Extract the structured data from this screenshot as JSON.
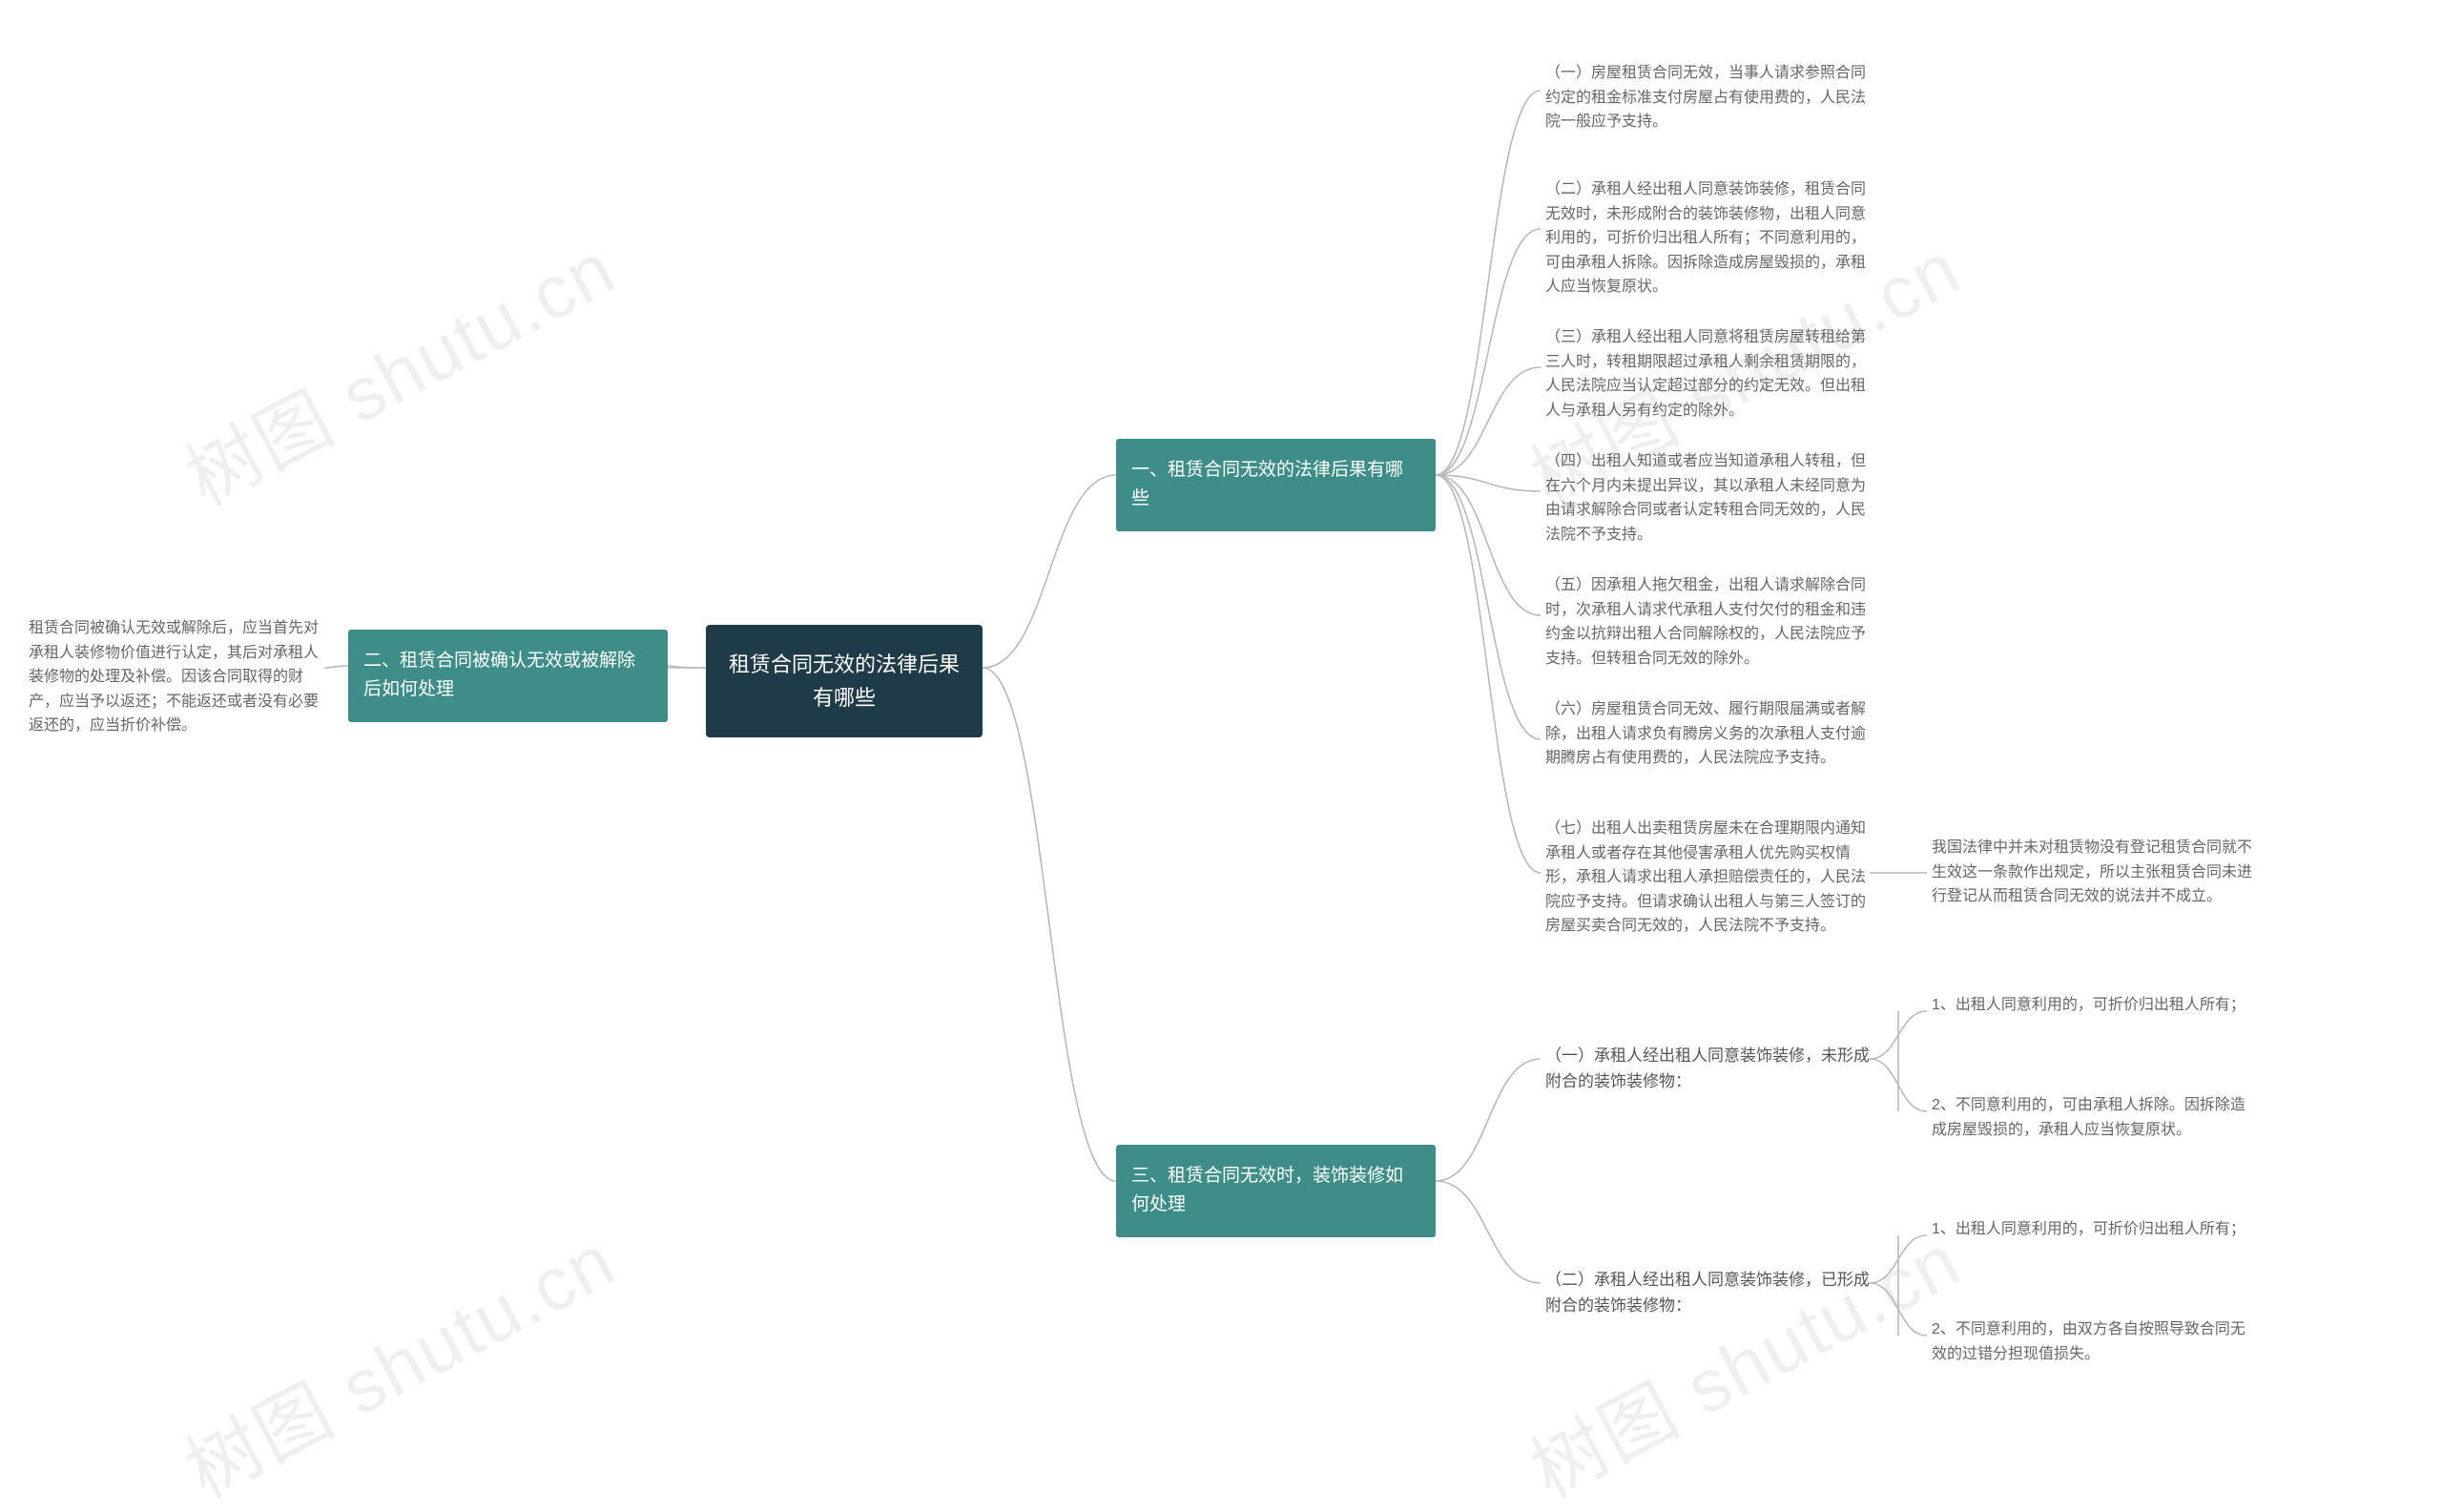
{
  "watermark": "树图 shutu.cn",
  "root": {
    "title": "租赁合同无效的法律后果\n有哪些"
  },
  "branch1": {
    "title": "一、租赁合同无效的法律后果有哪\n些",
    "items": [
      "（一）房屋租赁合同无效，当事人请求参照合同约定的租金标准支付房屋占有使用费的，人民法院一般应予支持。",
      "（二）承租人经出租人同意装饰装修，租赁合同无效时，未形成附合的装饰装修物，出租人同意利用的，可折价归出租人所有；不同意利用的，可由承租人拆除。因拆除造成房屋毁损的，承租人应当恢复原状。",
      "（三）承租人经出租人同意将租赁房屋转租给第三人时，转租期限超过承租人剩余租赁期限的，人民法院应当认定超过部分的约定无效。但出租人与承租人另有约定的除外。",
      "（四）出租人知道或者应当知道承租人转租，但在六个月内未提出异议，其以承租人未经同意为由请求解除合同或者认定转租合同无效的，人民法院不予支持。",
      "（五）因承租人拖欠租金，出租人请求解除合同时，次承租人请求代承租人支付欠付的租金和违约金以抗辩出租人合同解除权的，人民法院应予支持。但转租合同无效的除外。",
      "（六）房屋租赁合同无效、履行期限届满或者解除，出租人请求负有腾房义务的次承租人支付逾期腾房占有使用费的，人民法院应予支持。",
      "（七）出租人出卖租赁房屋未在合理期限内通知承租人或者存在其他侵害承租人优先购买权情形，承租人请求出租人承担赔偿责任的，人民法院应予支持。但请求确认出租人与第三人签订的房屋买卖合同无效的，人民法院不予支持。"
    ],
    "note": "我国法律中并未对租赁物没有登记租赁合同就不生效这一条款作出规定，所以主张租赁合同未进行登记从而租赁合同无效的说法并不成立。"
  },
  "branch2": {
    "title": "二、租赁合同被确认无效或被解除\n后如何处理",
    "detail": "租赁合同被确认无效或解除后，应当首先对承租人装修物价值进行认定，其后对承租人装修物的处理及补偿。因该合同取得的财产，应当予以返还；不能返还或者没有必要返还的，应当折价补偿。"
  },
  "branch3": {
    "title": "三、租赁合同无效时，装饰装修如\n何处理",
    "sub1": {
      "title": "（一）承租人经出租人同意装饰装修，未形成附合的装饰装修物：",
      "items": [
        "1、出租人同意利用的，可折价归出租人所有；",
        "2、不同意利用的，可由承租人拆除。因拆除造成房屋毁损的，承租人应当恢复原状。"
      ]
    },
    "sub2": {
      "title": "（二）承租人经出租人同意装饰装修，已形成附合的装饰装修物：",
      "items": [
        "1、出租人同意利用的，可折价归出租人所有；",
        "2、不同意利用的，由双方各自按照导致合同无效的过错分担现值损失。"
      ]
    }
  }
}
